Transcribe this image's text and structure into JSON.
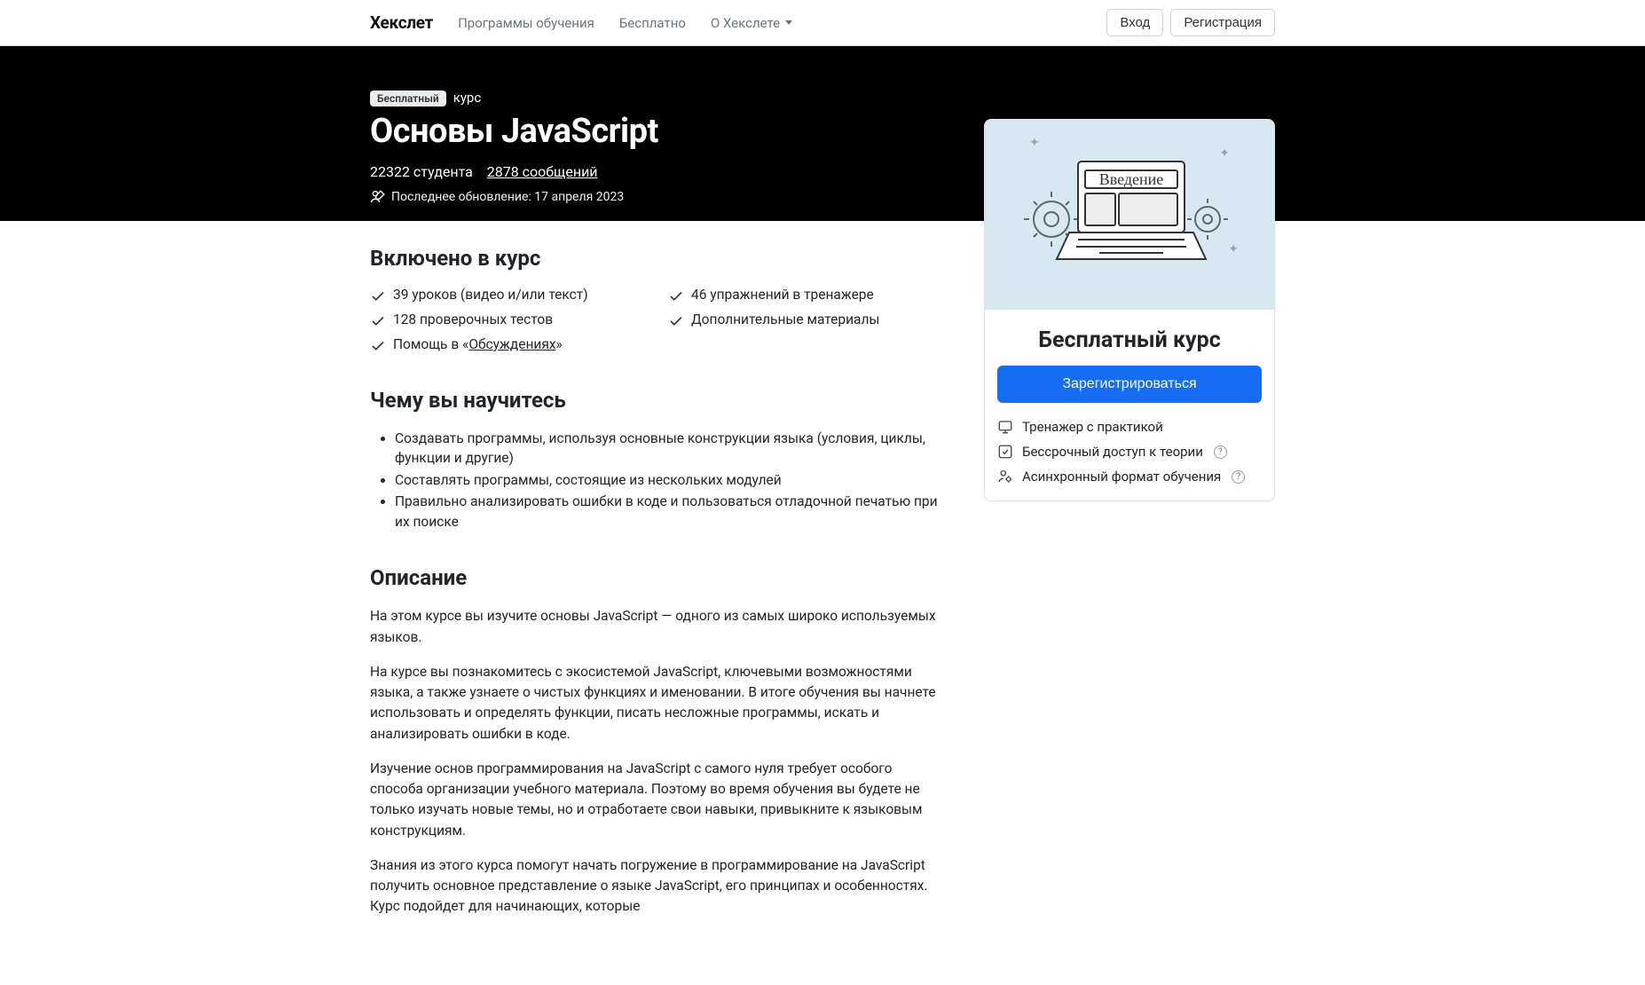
{
  "nav": {
    "logo": "Хекслет",
    "links": [
      "Программы обучения",
      "Бесплатно",
      "О Хекслете"
    ],
    "login": "Вход",
    "register": "Регистрация"
  },
  "hero": {
    "badge": "Бесплатный",
    "type": "курс",
    "title": "Основы JavaScript",
    "students": "22322 студента",
    "messages_count": "2878 сообщений",
    "updated": "Последнее обновление: 17 апреля 2023"
  },
  "included": {
    "title": "Включено в курс",
    "items_left": [
      "39 уроков (видео и/или текст)",
      "128 проверочных тестов"
    ],
    "help_prefix": "Помощь в «",
    "help_link": "Обсуждениях",
    "help_suffix": "»",
    "items_right": [
      "46 упражнений в тренажере",
      "Дополнительные материалы"
    ]
  },
  "learn": {
    "title": "Чему вы научитесь",
    "items": [
      "Создавать программы, используя основные конструкции языка (условия, циклы, функции и другие)",
      "Составлять программы, состоящие из нескольких модулей",
      "Правильно анализировать ошибки в коде и пользоваться отладочной печатью при их поиске"
    ]
  },
  "description": {
    "title": "Описание",
    "paragraphs": [
      "На этом курсе вы изучите основы JavaScript — одного из самых широко используемых языков.",
      "На курсе вы познакомитесь с экосистемой JavaScript, ключевыми возможностями языка, а также узнаете о чистых функциях и именовании. В итоге обучения вы начнете использовать и определять функции, писать несложные программы, искать и анализировать ошибки в коде.",
      "Изучение основ программирования на JavaScript с самого нуля требует особого способа организации учебного материала. Поэтому во время обучения вы будете не только изучать новые темы, но и отработаете свои навыки, привыкните к языковым конструкциям.",
      "Знания из этого курса помогут начать погружение в программирование на JavaScript получить основное представление о языке JavaScript, его принципах и особенностях. Курс подойдет для начинающих, которые"
    ]
  },
  "sidebar": {
    "illus_label": "Введение",
    "card_title": "Бесплатный курс",
    "cta": "Зарегистрироваться",
    "features": [
      "Тренажер с практикой",
      "Бессрочный доступ к теории",
      "Асинхронный формат обучения"
    ]
  }
}
